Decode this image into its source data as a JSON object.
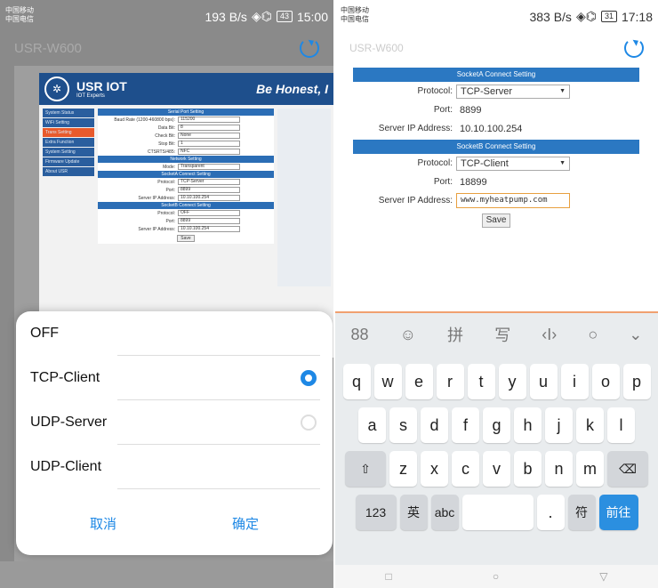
{
  "left": {
    "status": {
      "carrier1": "中国移动",
      "carrier2": "中国电信",
      "speed": "193 B/s",
      "battery": "43",
      "time": "15:00"
    },
    "title": "USR-W600",
    "web": {
      "brand": "USR IOT",
      "brand_sub": "IOT Experts",
      "slogan": "Be Honest, I",
      "nav": [
        "System Status",
        "WiFi Setting",
        "Trans Setting",
        "Extra Function",
        "System Setting",
        "Firmware Update",
        "About USR"
      ],
      "serial_title": "Serial Port Setting",
      "rows": [
        {
          "label": "Baud Rate (1200-460800 bps):",
          "value": "115200"
        },
        {
          "label": "Data Bit:",
          "value": "8"
        },
        {
          "label": "Check Bit:",
          "value": "None"
        },
        {
          "label": "Stop Bit:",
          "value": "1"
        },
        {
          "label": "CTSRTS/485:",
          "value": "NFC"
        }
      ],
      "network_title": "Network Setting",
      "mode_label": "Mode:",
      "mode_value": "Transparent",
      "socketa_title": "SocketA Connect Setting",
      "a_protocol": "TCP-Server",
      "a_port": "8899",
      "a_ip": "10.10.100.254",
      "socketb_title": "SocketB Connect Setting",
      "b_protocol": "OFF",
      "b_port": "8899",
      "b_ip": "10.10.100.254",
      "protocol_label": "Protocol:",
      "port_label": "Port:",
      "ip_label": "Server IP Address:",
      "save": "Save"
    },
    "dialog": {
      "options": [
        "OFF",
        "TCP-Client",
        "UDP-Server",
        "UDP-Client"
      ],
      "selected_index": 1,
      "cancel": "取消",
      "ok": "确定"
    }
  },
  "right": {
    "status": {
      "carrier1": "中国移动",
      "carrier2": "中国电信",
      "speed": "383 B/s",
      "battery": "31",
      "time": "17:18"
    },
    "title": "USR-W600",
    "socketa_title": "SocketA Connect Setting",
    "socketb_title": "SocketB Connect Setting",
    "protocol_label": "Protocol:",
    "port_label": "Port:",
    "ip_label": "Server IP Address:",
    "a_protocol": "TCP-Server",
    "a_port": "8899",
    "a_ip": "10.10.100.254",
    "b_protocol": "TCP-Client",
    "b_port": "18899",
    "b_ip": "www.myheatpump.com",
    "save": "Save",
    "keyboard": {
      "row1": [
        "q",
        "w",
        "e",
        "r",
        "t",
        "y",
        "u",
        "i",
        "o",
        "p"
      ],
      "row2": [
        "a",
        "s",
        "d",
        "f",
        "g",
        "h",
        "j",
        "k",
        "l"
      ],
      "row3": [
        "z",
        "x",
        "c",
        "v",
        "b",
        "n",
        "m"
      ],
      "num": "123",
      "lang": "英",
      "abc": "abc",
      "period": ".",
      "sym": "符",
      "go": "前往",
      "toolbar": [
        "88",
        "☺",
        "拼",
        "写",
        "‹I›",
        "○",
        "⌄"
      ]
    }
  }
}
